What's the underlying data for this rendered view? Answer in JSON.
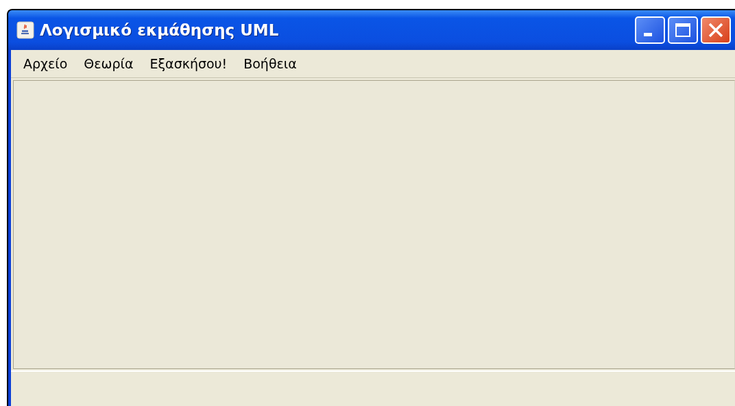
{
  "window": {
    "title": "Λογισμικό εκμάθησης UML"
  },
  "menu": [
    "Αρχείο",
    "Θεωρία",
    "Εξασκήσου!",
    "Βοήθεια"
  ]
}
